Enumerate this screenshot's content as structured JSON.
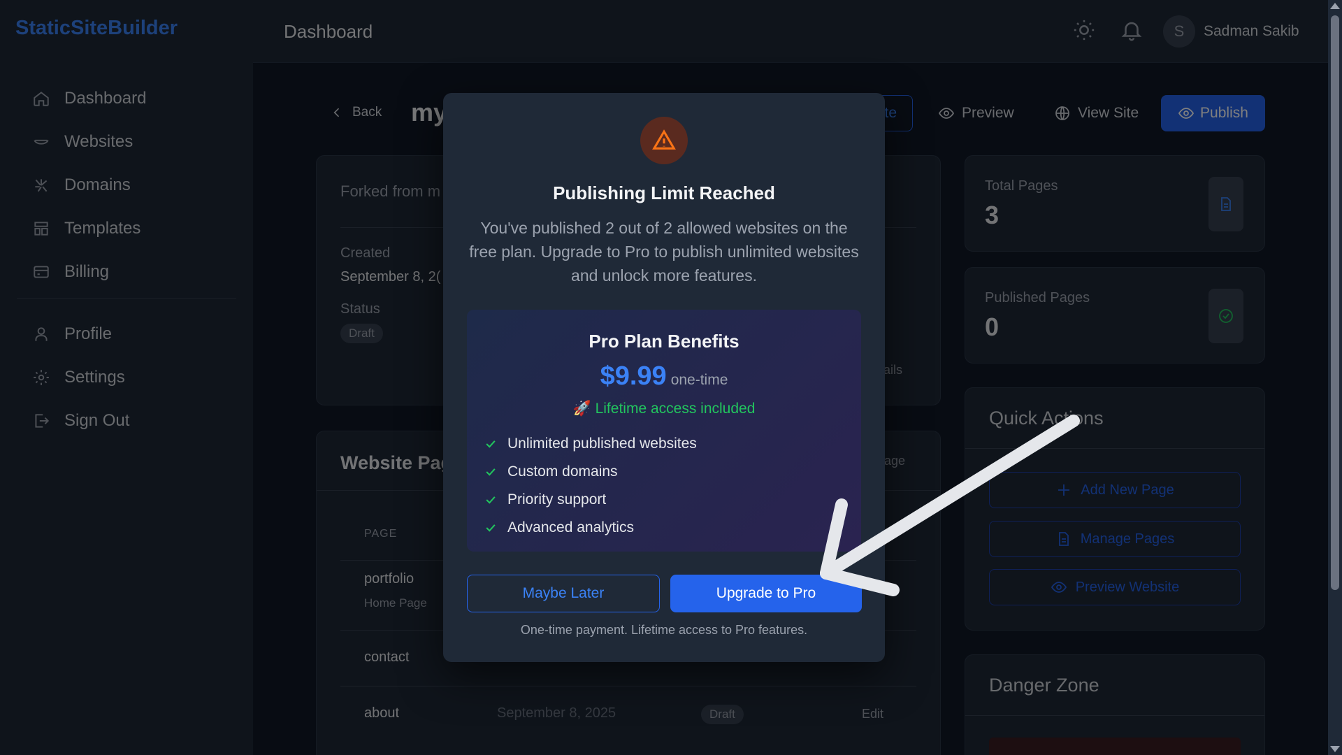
{
  "app": {
    "brand": "StaticSiteBuilder"
  },
  "sidebar": {
    "items": [
      {
        "label": "Dashboard",
        "icon": "home-icon"
      },
      {
        "label": "Websites",
        "icon": "globe-icon"
      },
      {
        "label": "Domains",
        "icon": "domain-icon"
      },
      {
        "label": "Templates",
        "icon": "template-icon"
      },
      {
        "label": "Billing",
        "icon": "card-icon"
      }
    ],
    "secondary": [
      {
        "label": "Profile",
        "icon": "user-icon"
      },
      {
        "label": "Settings",
        "icon": "gear-icon"
      },
      {
        "label": "Sign Out",
        "icon": "sign-out-icon"
      }
    ]
  },
  "header": {
    "title": "Dashboard",
    "avatar_initial": "S",
    "user_name": "Sadman Sakib"
  },
  "toolbar": {
    "back": "Back",
    "site_title": "my",
    "outline_btn_tail": "te",
    "preview": "Preview",
    "view_site": "View Site",
    "publish": "Publish"
  },
  "info": {
    "forked": "Forked from m",
    "created_label": "Created",
    "created_value": "September 8, 2(",
    "status_label": "Status",
    "status_value": "Draft",
    "details_tail": "tails"
  },
  "pages": {
    "title": "Website Pag",
    "add_tail": "age",
    "col_page": "PAGE",
    "rows": [
      {
        "name": "portfolio",
        "sub": "Home Page"
      },
      {
        "name": "contact"
      },
      {
        "name": "about",
        "date": "September 8, 2025",
        "status": "Draft",
        "action": "Edit"
      }
    ]
  },
  "stats": {
    "total_label": "Total Pages",
    "total_value": "3",
    "published_label": "Published Pages",
    "published_value": "0"
  },
  "quick_actions": {
    "title": "Quick Actions",
    "add_page": "Add New Page",
    "manage_pages": "Manage Pages",
    "preview_website": "Preview Website"
  },
  "danger": {
    "title": "Danger Zone"
  },
  "modal": {
    "title": "Publishing Limit Reached",
    "message": "You've published 2 out of 2 allowed websites on the free plan. Upgrade to Pro to publish unlimited websites and unlock more features.",
    "pro_title": "Pro Plan Benefits",
    "price": "$9.99",
    "price_note": "one-time",
    "lifetime": "🚀 Lifetime access included",
    "benefits": [
      "Unlimited published websites",
      "Custom domains",
      "Priority support",
      "Advanced analytics"
    ],
    "later_label": "Maybe Later",
    "upgrade_label": "Upgrade to Pro",
    "footnote": "One-time payment. Lifetime access to Pro features."
  },
  "colors": {
    "accent": "#2563eb",
    "success": "#22c55e",
    "warning": "#f97316",
    "background": "#111827"
  }
}
